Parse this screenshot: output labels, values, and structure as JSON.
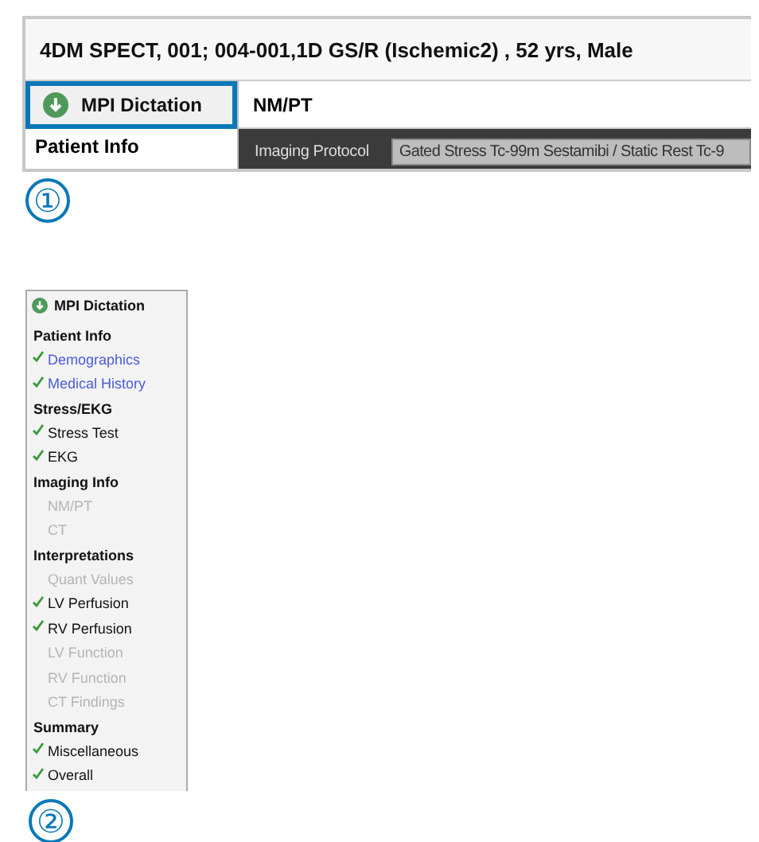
{
  "panel_1": {
    "title": "4DM SPECT, 001; 004-001,1D GS/R (Ischemic2) , 52 yrs, Male",
    "dictation_button": {
      "label": "MPI Dictation",
      "highlighted": true
    },
    "section_title": "NM/PT",
    "sidebar_heading": "Patient Info",
    "protocol": {
      "label": "Imaging Protocol",
      "value": "Gated Stress Tc-99m Sestamibi / Static Rest Tc-9"
    },
    "callout": "①"
  },
  "panel_2": {
    "dictation_button": {
      "label": "MPI Dictation",
      "highlighted": false
    },
    "groups": [
      {
        "heading": "Patient Info",
        "items": [
          {
            "label": "Demographics",
            "checked": true,
            "disabled": false,
            "link": true
          },
          {
            "label": "Medical History",
            "checked": true,
            "disabled": false,
            "link": true
          }
        ]
      },
      {
        "heading": "Stress/EKG",
        "items": [
          {
            "label": "Stress Test",
            "checked": true,
            "disabled": false,
            "link": false
          },
          {
            "label": "EKG",
            "checked": true,
            "disabled": false,
            "link": false
          }
        ]
      },
      {
        "heading": "Imaging Info",
        "items": [
          {
            "label": "NM/PT",
            "checked": false,
            "disabled": true,
            "link": false
          },
          {
            "label": "CT",
            "checked": false,
            "disabled": true,
            "link": false
          }
        ]
      },
      {
        "heading": "Interpretations",
        "items": [
          {
            "label": "Quant Values",
            "checked": false,
            "disabled": true,
            "link": false
          },
          {
            "label": "LV Perfusion",
            "checked": true,
            "disabled": false,
            "link": false
          },
          {
            "label": "RV Perfusion",
            "checked": true,
            "disabled": false,
            "link": false
          },
          {
            "label": "LV Function",
            "checked": false,
            "disabled": true,
            "link": false
          },
          {
            "label": "RV Function",
            "checked": false,
            "disabled": true,
            "link": false
          },
          {
            "label": "CT Findings",
            "checked": false,
            "disabled": true,
            "link": false
          }
        ]
      },
      {
        "heading": "Summary",
        "items": [
          {
            "label": "Miscellaneous",
            "checked": true,
            "disabled": false,
            "link": false
          },
          {
            "label": "Overall",
            "checked": true,
            "disabled": false,
            "link": false
          }
        ]
      }
    ],
    "callout": "②"
  }
}
